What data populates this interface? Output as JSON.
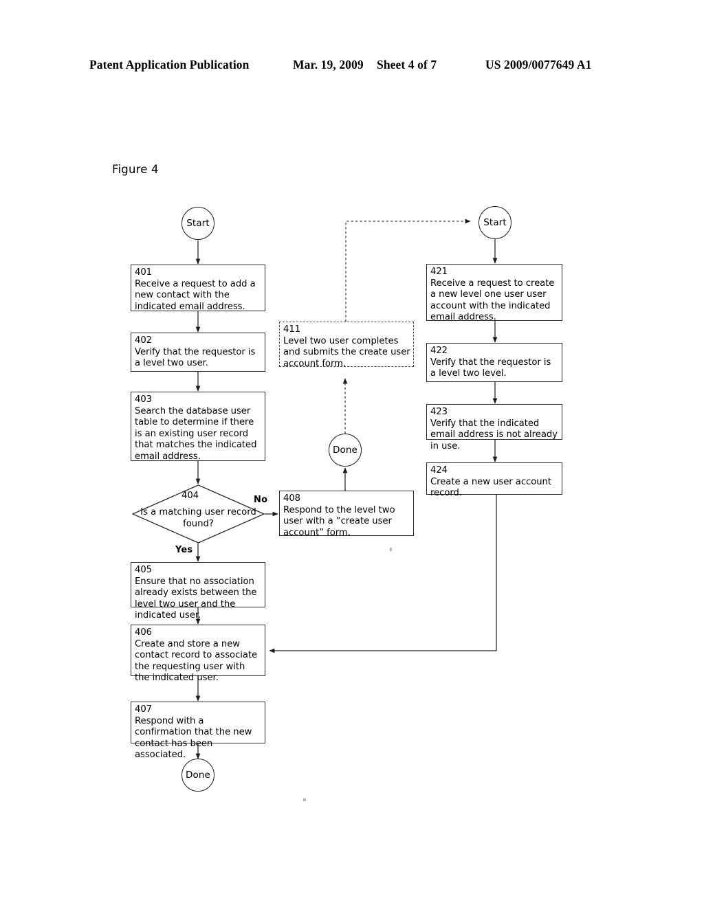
{
  "header": {
    "publication": "Patent Application Publication",
    "date": "Mar. 19, 2009",
    "sheet": "Sheet 4 of 7",
    "patent_number": "US 2009/0077649 A1"
  },
  "figure": {
    "caption": "Figure 4"
  },
  "terminators": {
    "start_left": "Start",
    "start_right": "Start",
    "done_middle": "Done",
    "done_bottom": "Done"
  },
  "edge_labels": {
    "yes": "Yes",
    "no": "No"
  },
  "nodes": {
    "n401": {
      "ref": "401",
      "text": "Receive a request to add a new contact with the indicated email address."
    },
    "n402": {
      "ref": "402",
      "text": "Verify that the requestor is a level two user."
    },
    "n403": {
      "ref": "403",
      "text": "Search the database user table to determine if there is an existing user record that matches the indicated email address."
    },
    "n404": {
      "ref": "404",
      "text": "Is a matching user record found?"
    },
    "n405": {
      "ref": "405",
      "text": "Ensure that no association already exists between the level two user and the indicated user."
    },
    "n406": {
      "ref": "406",
      "text": "Create and store a new contact record to associate the requesting user with the indicated user."
    },
    "n407": {
      "ref": "407",
      "text": "Respond with a confirmation that the new contact has been associated."
    },
    "n408": {
      "ref": "408",
      "text": "Respond to the level two user with a “create user account” form."
    },
    "n411": {
      "ref": "411",
      "text": "Level two user completes and submits the create user account form."
    },
    "n421": {
      "ref": "421",
      "text": "Receive a request to create a new level one user user account with the indicated email address."
    },
    "n422": {
      "ref": "422",
      "text": "Verify that the requestor is a level two level."
    },
    "n423": {
      "ref": "423",
      "text": "Verify that the indicated email address is not already in use."
    },
    "n424": {
      "ref": "424",
      "text": "Create a new user account record."
    }
  },
  "colors": {
    "ink": "#000000",
    "line": "#2a2a2a",
    "dashed_line": "#4a4a4a",
    "paper": "#ffffff"
  }
}
